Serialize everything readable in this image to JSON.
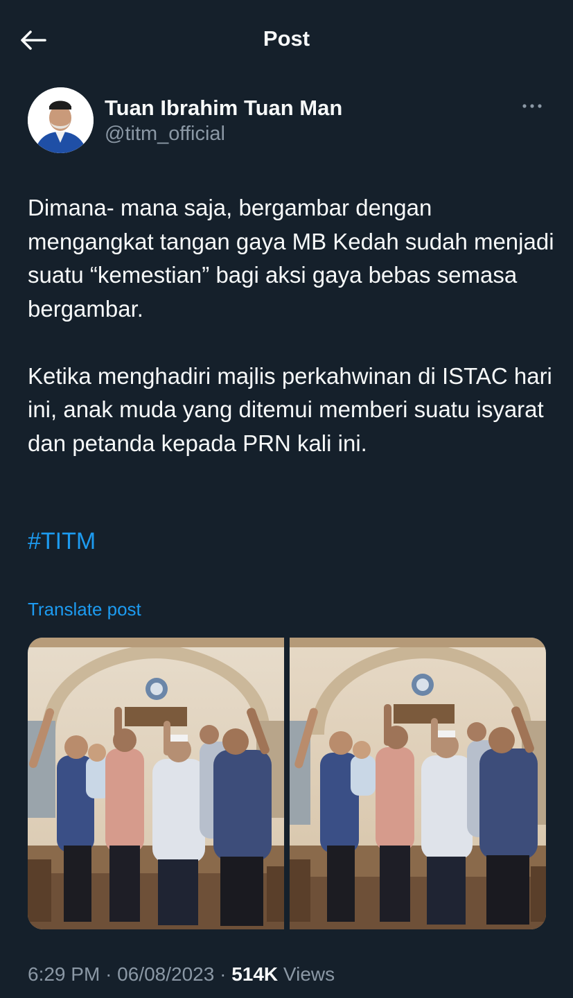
{
  "header": {
    "title": "Post"
  },
  "author": {
    "name": "Tuan Ibrahim Tuan Man",
    "handle": "@titm_official"
  },
  "post": {
    "text": "Dimana- mana saja, bergambar dengan mengangkat tangan gaya MB Kedah sudah menjadi suatu “kemestian” bagi aksi gaya bebas semasa bergambar.\n\nKetika menghadiri majlis perkahwinan di ISTAC hari ini, anak muda yang ditemui memberi suatu isyarat dan petanda kepada PRN kali ini.",
    "hashtag": "#TITM",
    "translate_label": "Translate post"
  },
  "media": {
    "count": 2
  },
  "meta": {
    "time": "6:29 PM",
    "separator": "·",
    "date": "06/08/2023",
    "views_count": "514K",
    "views_label": "Views"
  },
  "colors": {
    "background": "#15202b",
    "text_primary": "#f7f9f9",
    "text_secondary": "#8b98a5",
    "accent": "#1d9bf0"
  },
  "icons": {
    "back": "arrow-left-icon",
    "more": "more-horizontal-icon"
  }
}
